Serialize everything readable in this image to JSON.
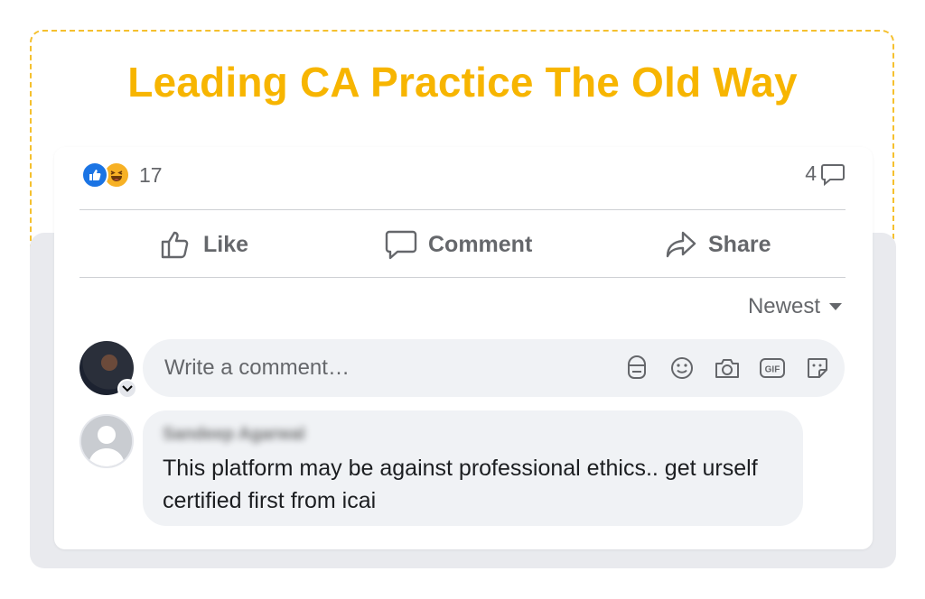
{
  "headline": "Leading CA Practice The Old Way",
  "post": {
    "reaction_count": "17",
    "comment_count": "4",
    "reactions": [
      "like-icon",
      "haha-icon"
    ]
  },
  "actions": {
    "like_label": "Like",
    "comment_label": "Comment",
    "share_label": "Share"
  },
  "sort": {
    "selected": "Newest"
  },
  "composer": {
    "placeholder": "Write a comment…",
    "icons": [
      "avatar-sticker-icon",
      "emoji-icon",
      "camera-icon",
      "gif-icon",
      "sticker-icon"
    ]
  },
  "comment": {
    "author": "Sandeep Agarwal",
    "text": "This platform may be against professional ethics.. get urself certified first from icai"
  },
  "colors": {
    "accent": "#f7b500",
    "facebook_blue": "#1b74e4",
    "muted_text": "#65676b",
    "bubble_bg": "#f0f2f5",
    "panel_bg": "#e9eaee"
  }
}
